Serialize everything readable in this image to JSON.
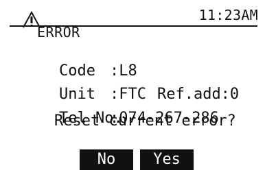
{
  "header": {
    "title": "ERROR",
    "time": "11:23AM",
    "icon": "warning-icon"
  },
  "details": {
    "code_label": "Code",
    "code_value": ":L8",
    "unit_label": "Unit",
    "unit_value": ":FTC",
    "ref_text": "Ref.add:0",
    "tel_label": "Tel No.",
    "tel_value": ":074-267-286"
  },
  "prompt": "Reset current error?",
  "buttons": {
    "no": "No",
    "yes": "Yes"
  },
  "colors": {
    "foreground": "#111111",
    "background": "#ffffff",
    "button_text": "#ffffff"
  }
}
